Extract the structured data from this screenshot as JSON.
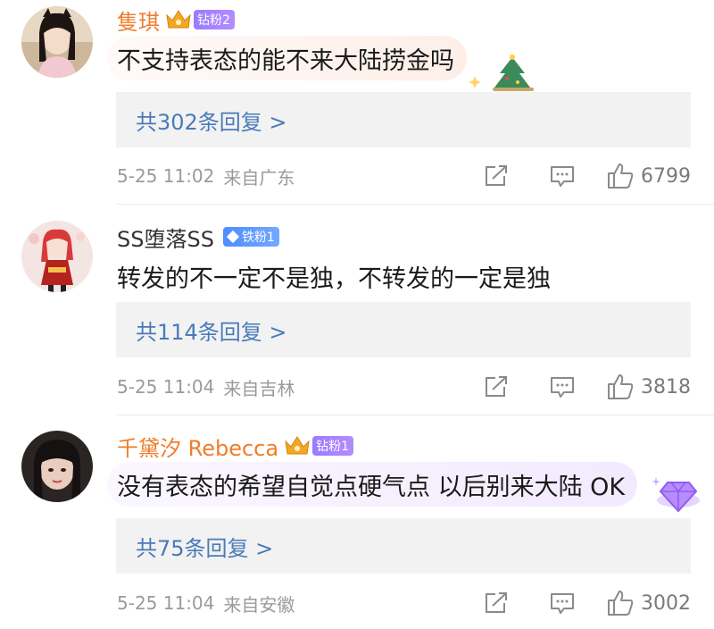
{
  "colors": {
    "vip_name": "#f07d2c",
    "normal_name": "#333333",
    "reply_link": "#4a7ab8",
    "meta": "#9a9a9a"
  },
  "comments": [
    {
      "username": "隻琪",
      "badge": "钻粉2",
      "text": "不支持表态的能不来大陆捞金吗",
      "replies": "共302条回复 >",
      "time": "5-25 11:02",
      "source": "来自广东",
      "likes": "6799"
    },
    {
      "username": "SS堕落SS",
      "badge": "铁粉1",
      "text": "转发的不一定不是独，不转发的一定是独",
      "replies": "共114条回复 >",
      "time": "5-25 11:04",
      "source": "来自吉林",
      "likes": "3818"
    },
    {
      "username": "千黛汐 Rebecca",
      "badge": "钻粉1",
      "text": "没有表态的希望自觉点硬气点 以后别来大陆 OK",
      "replies": "共75条回复 >",
      "time": "5-25 11:04",
      "source": "来自安徽",
      "likes": "3002"
    }
  ],
  "icons": {
    "share": "share-icon",
    "comment": "comment-icon",
    "like": "thumbs-up-icon",
    "crown": "crown-icon",
    "diamond": "diamond-icon"
  }
}
